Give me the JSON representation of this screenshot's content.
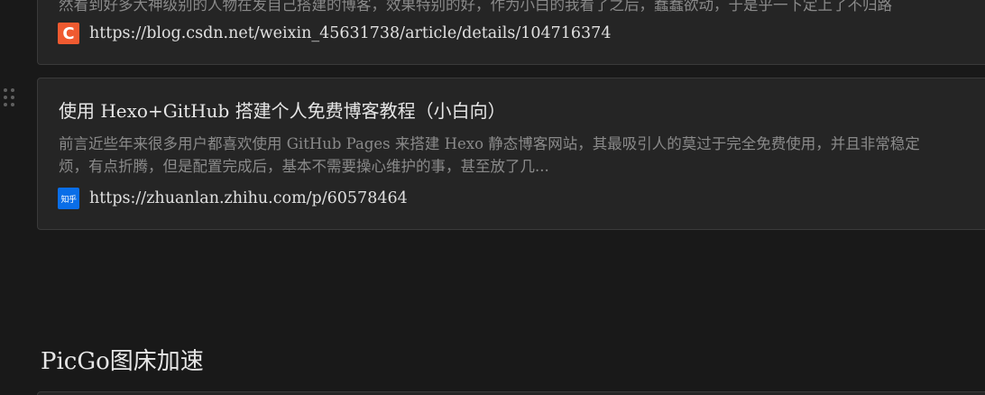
{
  "bookmarks": [
    {
      "title": "",
      "description_lines": [
        "然看到好多大神级别的人物在发自己搭建的博客，效果特别的好，作为小白的我看了之后，蠢蠢欲动，于是乎一下定上了不归路"
      ],
      "favicon": {
        "icon": "csdn-icon",
        "glyph": "C",
        "color": "#f05a30"
      },
      "url": "https://blog.csdn.net/weixin_45631738/article/details/104716374"
    },
    {
      "title": "使用 Hexo+GitHub 搭建个人免费博客教程（小白向）",
      "description_lines": [
        "前言近些年来很多用户都喜欢使用 GitHub Pages 来搭建 Hexo 静态博客网站，其最吸引人的莫过于完全免费使用，并且非常稳定",
        "烦，有点折腾，但是配置完成后，基本不需要操心维护的事，甚至放了几..."
      ],
      "favicon": {
        "icon": "zhihu-icon",
        "glyph": "知乎",
        "color": "#0a6ee8"
      },
      "url": "https://zhuanlan.zhihu.com/p/60578464"
    }
  ],
  "section_heading": "PicGo图床加速",
  "drag_handle_icon": "drag-handle-icon"
}
